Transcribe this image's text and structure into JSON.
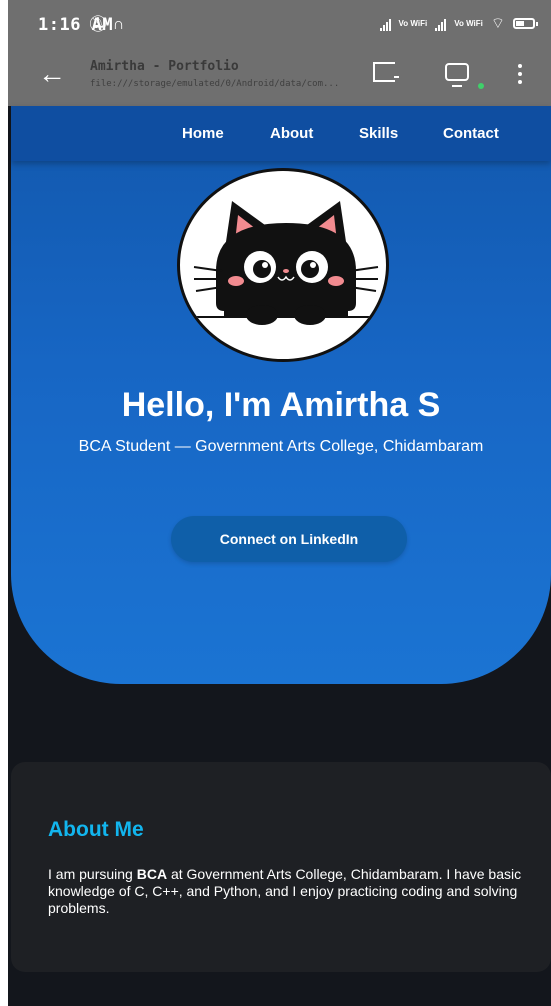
{
  "status_bar": {
    "time": "1:16 AM",
    "left_icons": [
      "mute-icon",
      "headset-icon"
    ],
    "network_1": "Vo WiFi",
    "network_2": "Vo WiFi"
  },
  "browser": {
    "page_title": "Amirtha - Portfolio",
    "url": "file:///storage/emulated/0/Android/data/com..."
  },
  "nav": {
    "items": [
      {
        "label": "Home"
      },
      {
        "label": "About"
      },
      {
        "label": "Skills"
      },
      {
        "label": "Contact"
      }
    ]
  },
  "hero": {
    "title": "Hello, I'm Amirtha S",
    "subtitle": "BCA Student — Government Arts College, Chidambaram",
    "button_label": "Connect on LinkedIn"
  },
  "about": {
    "heading": "About Me",
    "text_before": "I am pursuing ",
    "text_bold": "BCA",
    "text_after": " at Government Arts College, Chidambaram. I have basic knowledge of C, C++, and Python, and I enjoy practicing coding and solving problems."
  },
  "colors": {
    "hero_blue": "#1766c4",
    "nav_blue": "#0f4ea1",
    "accent_cyan": "#12b5ee",
    "page_dark": "#13161c"
  }
}
